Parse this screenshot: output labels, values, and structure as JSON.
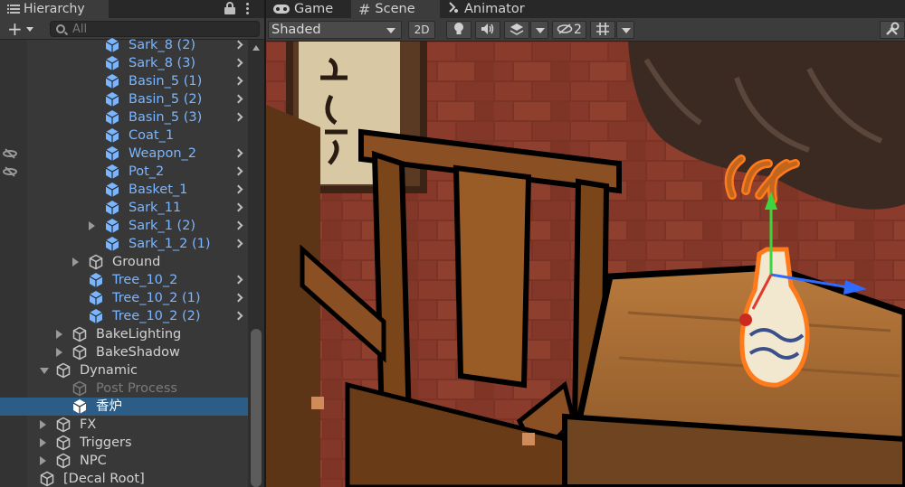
{
  "hierarchy": {
    "tab_label": "Hierarchy",
    "search_placeholder": "All",
    "add_label": "+",
    "rows": [
      {
        "label": "Sark_8 (2)",
        "color": "blue"
      },
      {
        "label": "Sark_8 (3)",
        "color": "blue"
      },
      {
        "label": "Basin_5 (1)",
        "color": "blue"
      },
      {
        "label": "Basin_5 (2)",
        "color": "blue"
      },
      {
        "label": "Basin_5 (3)",
        "color": "blue"
      },
      {
        "label": "Coat_1",
        "color": "blue"
      },
      {
        "label": "Weapon_2",
        "color": "blue"
      },
      {
        "label": "Pot_2",
        "color": "blue"
      },
      {
        "label": "Basket_1",
        "color": "blue"
      },
      {
        "label": "Sark_11",
        "color": "blue"
      },
      {
        "label": "Sark_1 (2)",
        "color": "blue"
      },
      {
        "label": "Sark_1_2 (1)",
        "color": "blue"
      },
      {
        "label": "Ground",
        "color": "white"
      },
      {
        "label": "Tree_10_2",
        "color": "blue"
      },
      {
        "label": "Tree_10_2 (1)",
        "color": "blue"
      },
      {
        "label": "Tree_10_2 (2)",
        "color": "blue"
      },
      {
        "label": "BakeLighting",
        "color": "white"
      },
      {
        "label": "BakeShadow",
        "color": "white"
      },
      {
        "label": "Dynamic",
        "color": "white"
      },
      {
        "label": "Post Process",
        "color": "gray"
      },
      {
        "label": "香炉",
        "color": "selected"
      },
      {
        "label": "FX",
        "color": "white"
      },
      {
        "label": "Triggers",
        "color": "white"
      },
      {
        "label": "NPC",
        "color": "white"
      },
      {
        "label": "[Decal Root]",
        "color": "white"
      }
    ]
  },
  "scene": {
    "tabs": [
      {
        "label": "Game",
        "icon": "gamepad-icon"
      },
      {
        "label": "Scene",
        "icon": "scene-grid-icon"
      },
      {
        "label": "Animator",
        "icon": "animator-icon"
      }
    ],
    "shading_mode": "Shaded",
    "mode_2d_label": "2D",
    "hidden_count": "2"
  },
  "colors": {
    "selection": "#2c5d87",
    "prefab_blue": "#7ab6ff",
    "panel_bg": "#383838",
    "outline_orange": "#ff7a1a"
  }
}
